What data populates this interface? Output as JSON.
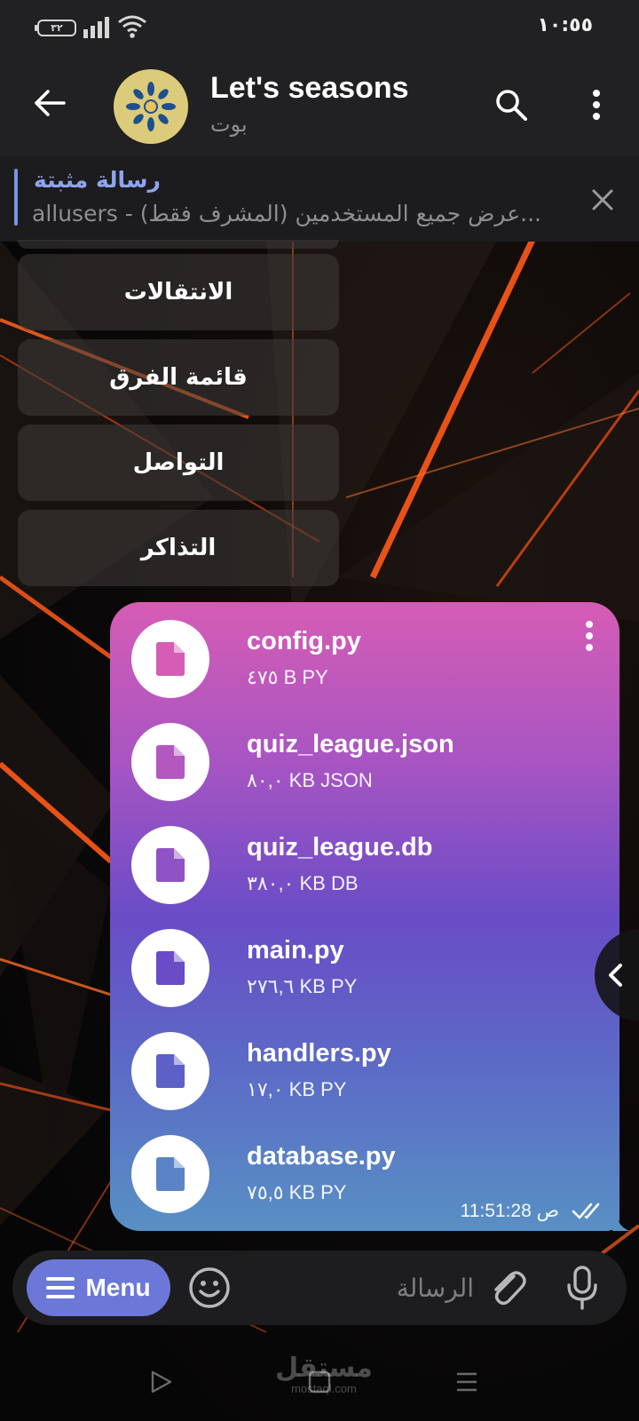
{
  "status_bar": {
    "time": "١٠:٥٥",
    "battery": "٣٢",
    "icons": [
      "battery-icon",
      "signal-icon",
      "wifi-icon"
    ]
  },
  "header": {
    "title": "Let's seasons",
    "subtitle": "بوت",
    "icons": [
      "back-arrow-icon",
      "bot-avatar",
      "search-icon",
      "more-vertical-icon"
    ]
  },
  "pinned": {
    "label": "رسالة مثبتة",
    "text": "allusers - عرض جميع المستخدمين (المشرف فقط)...",
    "close_icon": "close-icon"
  },
  "keyboard": {
    "buttons": [
      {
        "label": "الانتقالات"
      },
      {
        "label": "قائمة الفرق"
      },
      {
        "label": "التواصل"
      },
      {
        "label": "التذاكر"
      }
    ]
  },
  "message": {
    "files": [
      {
        "name": "config.py",
        "meta": "٤٧٥ B PY"
      },
      {
        "name": "quiz_league.json",
        "meta": "٨٠,٠ KB JSON"
      },
      {
        "name": "quiz_league.db",
        "meta": "٣٨٠,٠ KB DB"
      },
      {
        "name": "main.py",
        "meta": "٢٧٦,٦ KB PY"
      },
      {
        "name": "handlers.py",
        "meta": "١٧,٠ KB PY"
      },
      {
        "name": "database.py",
        "meta": "٧٥,٥ KB PY"
      }
    ],
    "time": "11:51:28 ص",
    "status_icon": "double-check-icon",
    "colors": {
      "top": "#d65cb5",
      "middle": "#6a4cc7",
      "bottom": "#5890c4"
    }
  },
  "input_bar": {
    "menu_label": "Menu",
    "placeholder": "الرسالة",
    "icons": [
      "hamburger-icon",
      "emoji-icon",
      "attach-icon",
      "mic-icon"
    ]
  },
  "nav_bar": {
    "watermark_main": "مستقل",
    "watermark_sub": "mostaql.com"
  },
  "colors": {
    "accent": "#6b78d8",
    "header_bg": "#212123",
    "pinned_accent": "#8fa3ee"
  }
}
